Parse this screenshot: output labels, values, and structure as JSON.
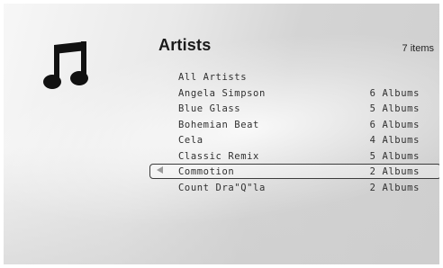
{
  "header": {
    "title": "Artists",
    "item_count": "7 items"
  },
  "icons": {
    "category": "music-note-icon"
  },
  "list": {
    "items": [
      {
        "name": "All Artists",
        "albums": ""
      },
      {
        "name": "Angela Simpson",
        "albums": "6 Albums"
      },
      {
        "name": "Blue Glass",
        "albums": "5 Albums"
      },
      {
        "name": "Bohemian Beat",
        "albums": "6 Albums"
      },
      {
        "name": "Cela",
        "albums": "4 Albums"
      },
      {
        "name": "Classic Remix",
        "albums": "5 Albums"
      },
      {
        "name": "Commotion",
        "albums": "2 Albums"
      },
      {
        "name": "Count Dra\"Q\"la",
        "albums": "2 Albums"
      }
    ],
    "selected_index": 6
  },
  "colors": {
    "text": "#303030",
    "selection_border": "#3b3b3b"
  }
}
